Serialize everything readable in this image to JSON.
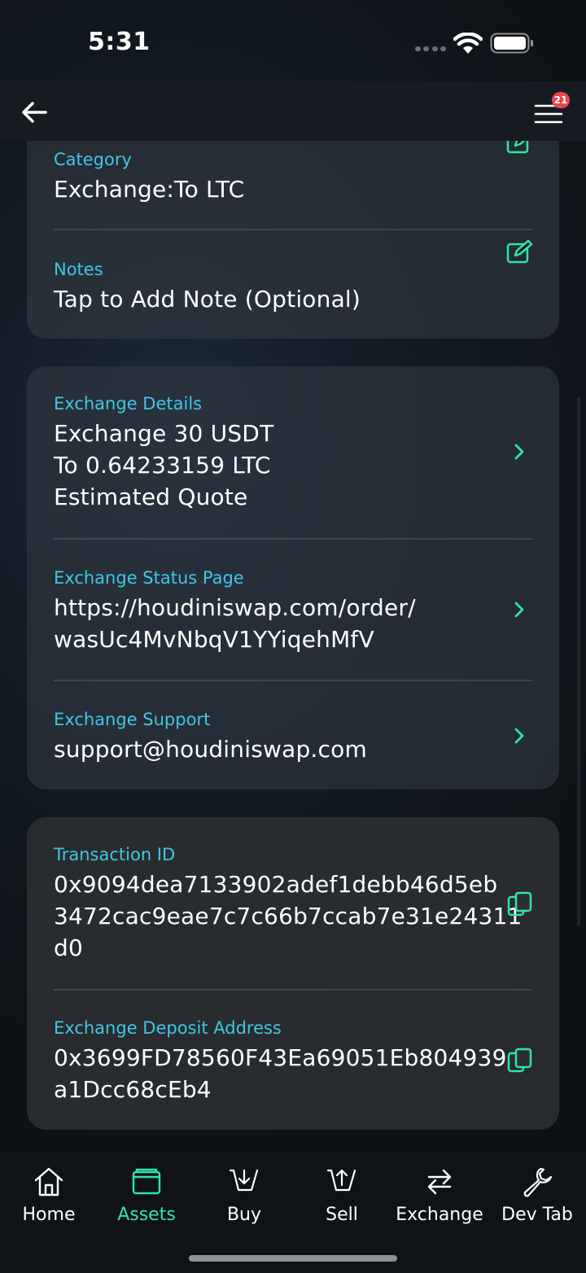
{
  "status_bar": {
    "time": "5:31"
  },
  "nav": {
    "badge_count": "21"
  },
  "card_notes": {
    "category_label": "Category",
    "category_value": "Exchange:To LTC",
    "notes_label": "Notes",
    "notes_value": "Tap to Add Note (Optional)"
  },
  "card_exchange": {
    "details_label": "Exchange Details",
    "details_line1": "Exchange 30 USDT",
    "details_line2": "To 0.64233159 LTC",
    "details_line3": "Estimated Quote",
    "status_label": "Exchange Status Page",
    "status_line1": "https://houdiniswap.com/order/",
    "status_line2": "wasUc4MvNbqV1YYiqehMfV",
    "support_label": "Exchange Support",
    "support_value": "support@houdiniswap.com"
  },
  "card_tx": {
    "txid_label": "Transaction ID",
    "txid_line1": "0x9094dea7133902adef1debb46d5eb",
    "txid_line2": "3472cac9eae7c7c66b7ccab7e31e24311",
    "txid_line3": "d0",
    "deposit_label": "Exchange Deposit Address",
    "deposit_line1": "0x3699FD78560F43Ea69051Eb804939",
    "deposit_line2": "a1Dcc68cEb4"
  },
  "tabs": [
    {
      "label": "Home",
      "icon": "home-icon"
    },
    {
      "label": "Assets",
      "icon": "wallet-icon"
    },
    {
      "label": "Buy",
      "icon": "buy-icon"
    },
    {
      "label": "Sell",
      "icon": "sell-icon"
    },
    {
      "label": "Exchange",
      "icon": "exchange-arrows-icon"
    },
    {
      "label": "Dev Tab",
      "icon": "wrench-icon"
    }
  ],
  "active_tab": "Assets",
  "colors": {
    "accent_green": "#2ee6a6",
    "label_cyan": "#3fc8e4",
    "badge_red": "#e5484d"
  }
}
